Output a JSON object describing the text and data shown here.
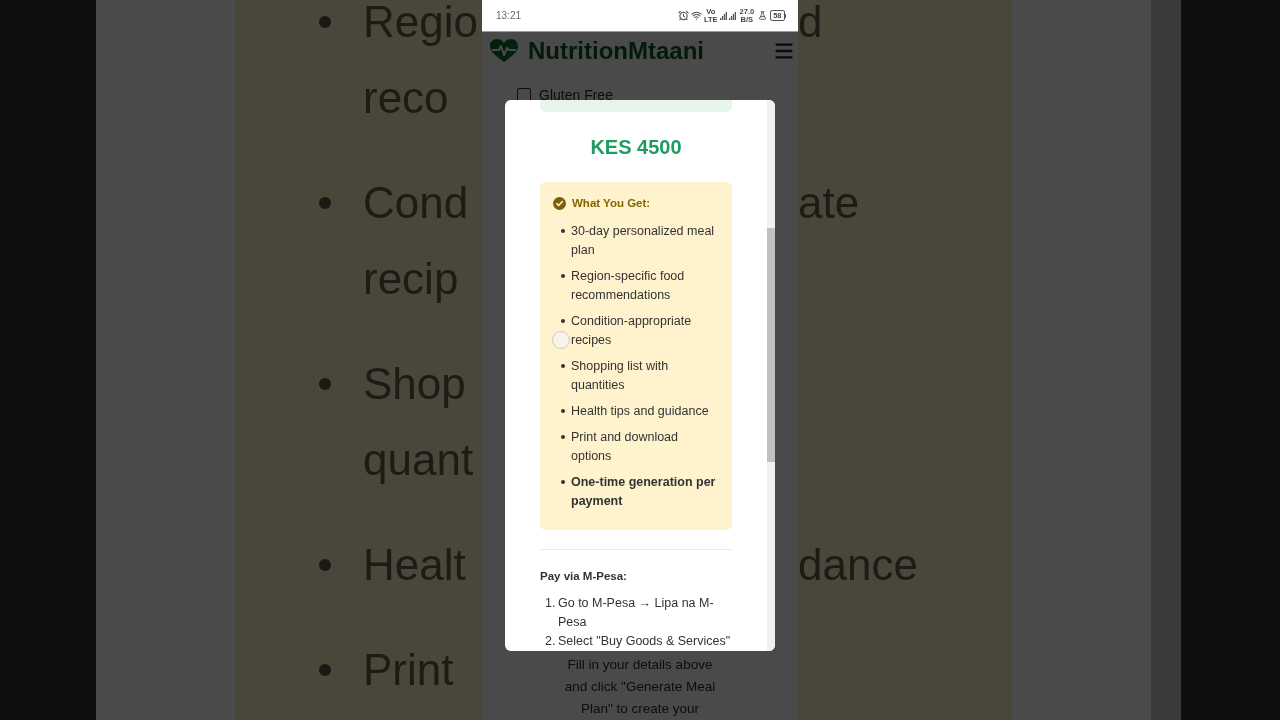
{
  "backdrop": {
    "items": [
      {
        "lines": [
          {
            "left": "Regio",
            "right": "d"
          },
          {
            "left": "reco"
          }
        ]
      },
      {
        "lines": [
          {
            "left": "Cond",
            "right": "ate"
          },
          {
            "left": "recip"
          }
        ]
      },
      {
        "lines": [
          {
            "left": "Shop"
          },
          {
            "left": "quant"
          }
        ]
      },
      {
        "lines": [
          {
            "left": "Healt",
            "right": "dance"
          }
        ]
      },
      {
        "lines": [
          {
            "left": "Print"
          }
        ]
      }
    ]
  },
  "status_bar": {
    "time": "13:21",
    "volte": [
      "Vo",
      "LTE"
    ],
    "net_speed": [
      "27.0",
      "B/S"
    ],
    "battery": "58"
  },
  "header": {
    "brand": "NutritionMtaani"
  },
  "form": {
    "options": [
      {
        "label": "Gluten Free",
        "checked": false
      }
    ],
    "hint": "Fill in your details above and click \"Generate Meal Plan\" to create your"
  },
  "modal": {
    "price": "KES 4500",
    "features": {
      "title": "What You Get:",
      "items": [
        {
          "text": "30-day personalized meal plan",
          "kind": "normal"
        },
        {
          "text": "Region-specific food recommendations",
          "kind": "normal"
        },
        {
          "text": "Condition-appropriate recipes",
          "kind": "normal"
        },
        {
          "text": "Shopping list with quantities",
          "kind": "normal"
        },
        {
          "text": "Health tips and guidance",
          "kind": "normal"
        },
        {
          "text": "Print and download options",
          "kind": "normal"
        },
        {
          "text": "One-time generation per payment",
          "kind": "highlight"
        }
      ]
    },
    "payment": {
      "title": "Pay via M-Pesa:",
      "steps": [
        {
          "number": "1.",
          "text": "Go to M-Pesa → Lipa na M-Pesa"
        },
        {
          "number": "2.",
          "text": "Select \"Buy Goods & Services\""
        }
      ]
    }
  }
}
